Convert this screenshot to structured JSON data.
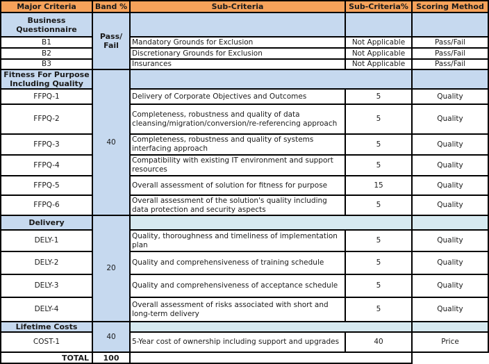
{
  "headers": {
    "major": "Major Criteria",
    "band": "Band %",
    "sub": "Sub-Criteria",
    "subpct": "Sub-Criteria%",
    "scoring": "Scoring Method"
  },
  "sections": {
    "business": {
      "title": "Business Questionnaire",
      "band": "Pass/ Fail",
      "rows": [
        {
          "id": "B1",
          "sub": "Mandatory Grounds for Exclusion",
          "pct": "Not Applicable",
          "method": "Pass/Fail"
        },
        {
          "id": "B2",
          "sub": "Discretionary Grounds for Exclusion",
          "pct": "Not Applicable",
          "method": "Pass/Fail"
        },
        {
          "id": "B3",
          "sub": "Insurances",
          "pct": "Not Applicable",
          "method": "Pass/Fail"
        }
      ]
    },
    "fitness": {
      "title": "Fitness For Purpose Including Quality",
      "band": "40",
      "rows": [
        {
          "id": "FFPQ-1",
          "sub": "Delivery of Corporate Objectives and Outcomes",
          "pct": "5",
          "method": "Quality"
        },
        {
          "id": "FFPQ-2",
          "sub": "Completeness, robustness and quality of data cleansing/migration/conversion/re-referencing approach",
          "pct": "5",
          "method": "Quality"
        },
        {
          "id": "FFPQ-3",
          "sub": "Completeness, robustness and quality of systems interfacing approach",
          "pct": "5",
          "method": "Quality"
        },
        {
          "id": "FFPQ-4",
          "sub": "Compatibility with existing IT environment and support resources",
          "pct": "5",
          "method": "Quality"
        },
        {
          "id": "FFPQ-5",
          "sub": "Overall assessment of solution for fitness for purpose",
          "pct": "15",
          "method": "Quality"
        },
        {
          "id": "FFPQ-6",
          "sub": "Overall assessment of the solution's quality including data protection and security aspects",
          "pct": "5",
          "method": "Quality"
        }
      ]
    },
    "delivery": {
      "title": "Delivery",
      "band": "20",
      "rows": [
        {
          "id": "DELY-1",
          "sub": "Quality, thoroughness and timeliness of implementation plan",
          "pct": "5",
          "method": "Quality"
        },
        {
          "id": "DELY-2",
          "sub": "Quality and comprehensiveness of training schedule",
          "pct": "5",
          "method": "Quality"
        },
        {
          "id": "DELY-3",
          "sub": "Quality and comprehensiveness of acceptance schedule",
          "pct": "5",
          "method": "Quality"
        },
        {
          "id": "DELY-4",
          "sub": "Overall assessment of risks associated with short and long-term delivery",
          "pct": "5",
          "method": "Quality"
        }
      ]
    },
    "lifetime": {
      "title": "Lifetime Costs",
      "band": "40",
      "rows": [
        {
          "id": "COST-1",
          "sub": "5-Year cost of ownership including support and upgrades",
          "pct": "40",
          "method": "Price"
        }
      ]
    }
  },
  "total": {
    "label": "TOTAL",
    "value": "100"
  },
  "colors": {
    "header": "#f6a25a",
    "section": "#c6d9ef",
    "section_light": "#d6e9f0"
  }
}
